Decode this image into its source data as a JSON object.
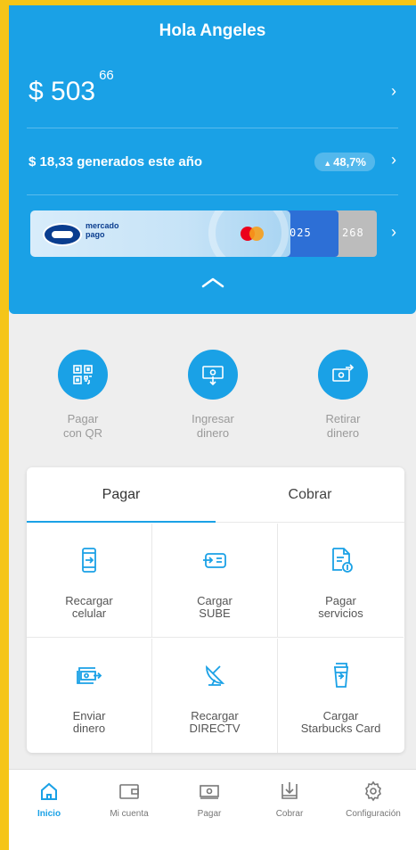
{
  "header": {
    "greeting": "Hola Angeles",
    "balance_int": "$ 503",
    "balance_cents": "66",
    "earnings_text": "$ 18,33 generados este año",
    "earnings_badge": "48,7%",
    "card": {
      "brand_line1": "mercado",
      "brand_line2": "pago",
      "digits_a": "025",
      "digits_b": "268"
    }
  },
  "quick_actions": [
    {
      "label": "Pagar\ncon QR",
      "icon": "qr-icon"
    },
    {
      "label": "Ingresar\ndinero",
      "icon": "deposit-icon"
    },
    {
      "label": "Retirar\ndinero",
      "icon": "withdraw-icon"
    }
  ],
  "tabs": [
    {
      "label": "Pagar",
      "active": true
    },
    {
      "label": "Cobrar",
      "active": false
    }
  ],
  "services": [
    {
      "label": "Recargar\ncelular",
      "icon": "phone-topup-icon"
    },
    {
      "label": "Cargar\nSUBE",
      "icon": "transit-card-icon"
    },
    {
      "label": "Pagar\nservicios",
      "icon": "bill-icon"
    },
    {
      "label": "Enviar\ndinero",
      "icon": "send-money-icon"
    },
    {
      "label": "Recargar\nDIRECTV",
      "icon": "satellite-dish-icon"
    },
    {
      "label": "Cargar\nStarbucks Card",
      "icon": "coffee-cup-icon"
    }
  ],
  "nav": [
    {
      "label": "Inicio",
      "icon": "home-icon",
      "active": true
    },
    {
      "label": "Mi cuenta",
      "icon": "wallet-icon",
      "active": false
    },
    {
      "label": "Pagar",
      "icon": "pay-icon",
      "active": false
    },
    {
      "label": "Cobrar",
      "icon": "charge-icon",
      "active": false
    },
    {
      "label": "Configuración",
      "icon": "gear-icon",
      "active": false
    }
  ],
  "colors": {
    "primary": "#1aa1e6",
    "frame": "#f5c518",
    "background": "#eeeeee"
  }
}
